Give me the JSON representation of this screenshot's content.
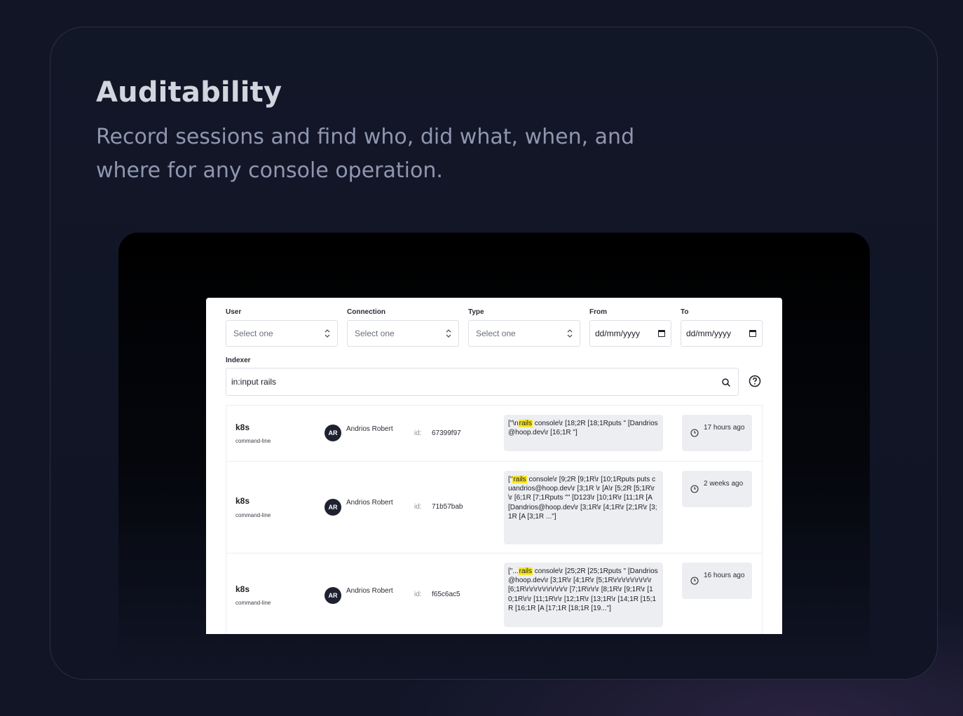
{
  "heading": "Auditability",
  "subtitle": "Record sessions and find who, did what, when, and where for any console operation.",
  "filters": {
    "user": {
      "label": "User",
      "value": "Select one"
    },
    "connection": {
      "label": "Connection",
      "value": "Select one"
    },
    "type": {
      "label": "Type",
      "value": "Select one"
    },
    "from": {
      "label": "From",
      "value": "dd/mm/yyyy"
    },
    "to": {
      "label": "To",
      "value": "dd/mm/yyyy"
    }
  },
  "indexer": {
    "label": "Indexer",
    "value": "in:input  rails"
  },
  "sessions": [
    {
      "name": "k8s",
      "type": "command-line",
      "avatar": "AR",
      "user": "Andrios Robert",
      "id_label": "id:",
      "id": "67399f97",
      "log_pre": "[\"\\n",
      "log_hl": "rails",
      "log_post": " console\\r [18;2R [18;1Rputs \" [Dandrios@hoop.dev\\r [16;1R  \"]",
      "time": "17 hours ago"
    },
    {
      "name": "k8s",
      "type": "command-line",
      "avatar": "AR",
      "user": "Andrios Robert",
      "id_label": "id:",
      "id": "71b57bab",
      "log_pre": "[\"",
      "log_hl": "rails",
      "log_post": " console\\r [9;2R [9;1R\\r [10;1Rputs puts cuandrios@hoop.dev\\r [3;1R \\r [A\\r [5;2R [5;1R\\r\\r [6;1R [7;1Rputs \"\" [D123\\r [10;1R\\r [11;1R [A [Dandrios@hoop.dev\\r [3;1R\\r [4;1R\\r [2;1R\\r [3;1R [A  [3;1R ...\"]",
      "time": "2 weeks ago"
    },
    {
      "name": "k8s",
      "type": "command-line",
      "avatar": "AR",
      "user": "Andrios Robert",
      "id_label": "id:",
      "id": "f65c6ac5",
      "log_pre": "[\"...",
      "log_hl": "rails",
      "log_post": " console\\r [25;2R [25;1Rputs \" [Dandrios@hoop.dev\\r [3;1R\\r [4;1R\\r [5;1R\\r\\r\\r\\r\\r\\r\\r\\r\\r [6;1R\\r\\r\\r\\r\\r\\r\\r\\r\\r\\r [7;1R\\r\\r\\r [8;1R\\r [9;1R\\r [10;1R\\r\\r [11;1R\\r\\r [12;1R\\r [13;1R\\r [14;1R [15;1R [16;1R [A [17;1R [18;1R [19...\"]",
      "time": "16 hours ago"
    }
  ]
}
